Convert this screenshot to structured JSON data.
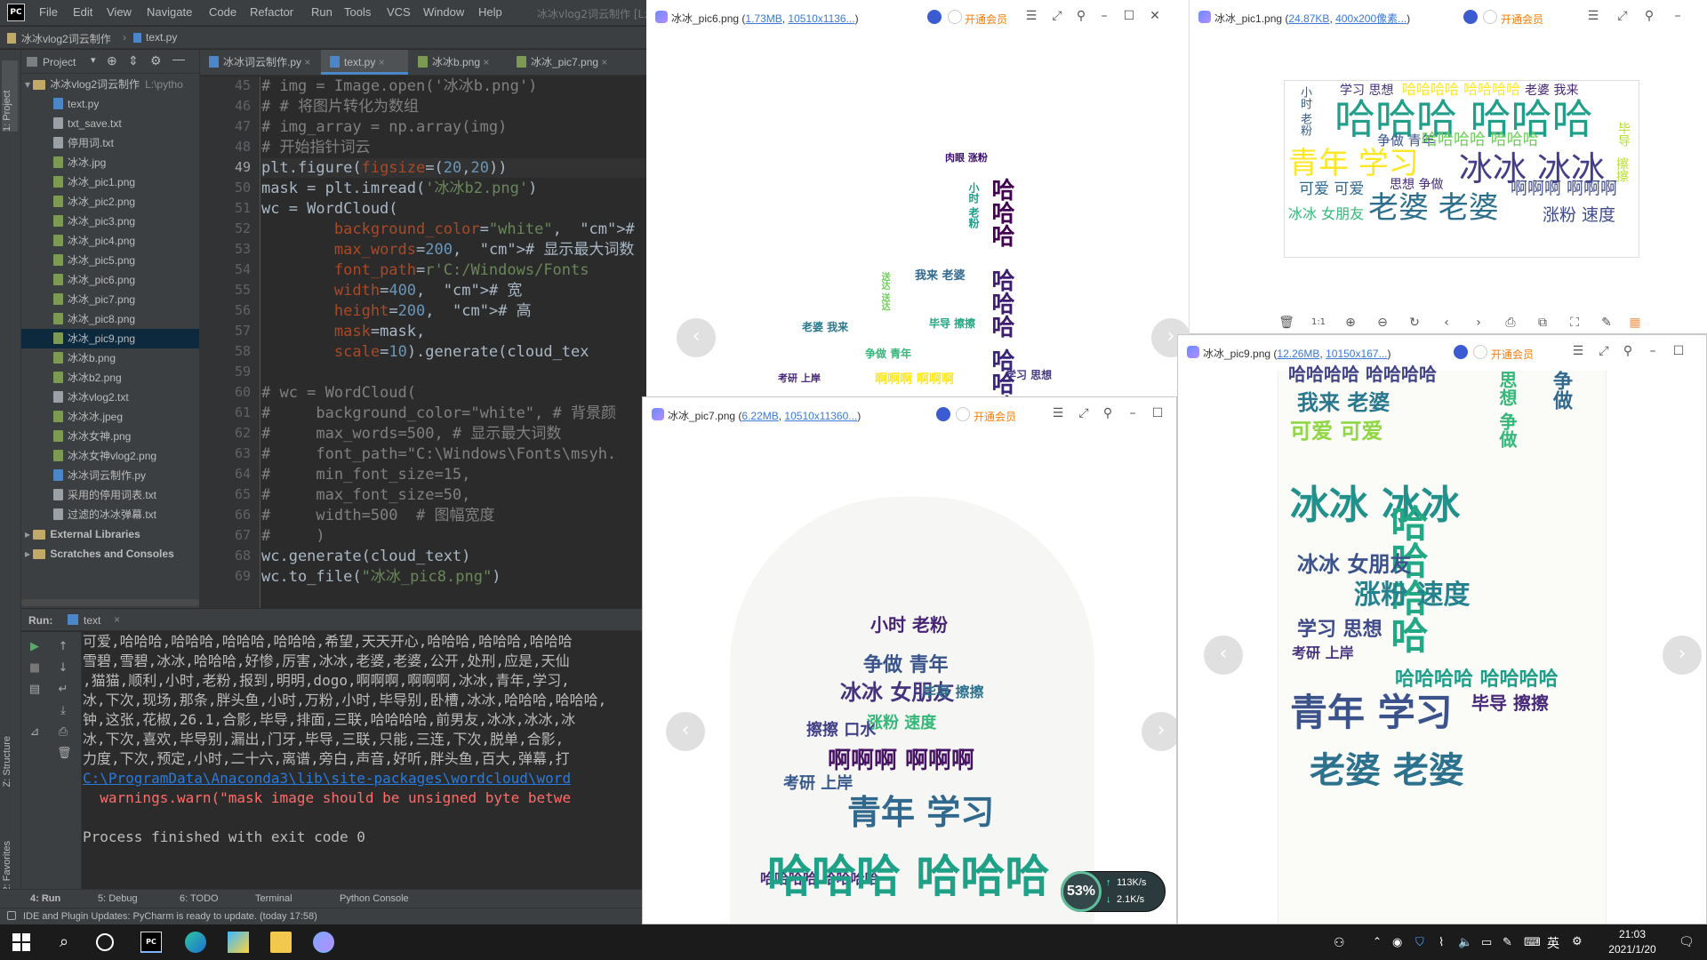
{
  "pycharm": {
    "menus": [
      "File",
      "Edit",
      "View",
      "Navigate",
      "Code",
      "Refactor",
      "Run",
      "Tools",
      "VCS",
      "Window",
      "Help"
    ],
    "window_title": "冰冰vlog2词云制作 [L:",
    "breadcrumb": {
      "project": "冰冰vlog2词云制作",
      "file": "text.py"
    },
    "project_panel": {
      "title": "Project",
      "items": [
        {
          "label": "冰冰vlog2词云制作",
          "suffix": "L:\\pytho",
          "type": "dir",
          "depth": 0
        },
        {
          "label": "text.py",
          "type": "py",
          "depth": 1
        },
        {
          "label": "txt_save.txt",
          "type": "txt",
          "depth": 1
        },
        {
          "label": "停用词.txt",
          "type": "txt",
          "depth": 1
        },
        {
          "label": "冰冰.jpg",
          "type": "img",
          "depth": 1
        },
        {
          "label": "冰冰_pic1.png",
          "type": "img",
          "depth": 1
        },
        {
          "label": "冰冰_pic2.png",
          "type": "img",
          "depth": 1
        },
        {
          "label": "冰冰_pic3.png",
          "type": "img",
          "depth": 1
        },
        {
          "label": "冰冰_pic4.png",
          "type": "img",
          "depth": 1
        },
        {
          "label": "冰冰_pic5.png",
          "type": "img",
          "depth": 1
        },
        {
          "label": "冰冰_pic6.png",
          "type": "img",
          "depth": 1
        },
        {
          "label": "冰冰_pic7.png",
          "type": "img",
          "depth": 1
        },
        {
          "label": "冰冰_pic8.png",
          "type": "img",
          "depth": 1
        },
        {
          "label": "冰冰_pic9.png",
          "type": "img",
          "depth": 1,
          "selected": true
        },
        {
          "label": "冰冰b.png",
          "type": "img",
          "depth": 1
        },
        {
          "label": "冰冰b2.png",
          "type": "img",
          "depth": 1
        },
        {
          "label": "冰冰vlog2.txt",
          "type": "txt",
          "depth": 1
        },
        {
          "label": "冰冰冰.jpeg",
          "type": "img",
          "depth": 1
        },
        {
          "label": "冰冰女神.png",
          "type": "img",
          "depth": 1
        },
        {
          "label": "冰冰女神vlog2.png",
          "type": "img",
          "depth": 1
        },
        {
          "label": "冰冰词云制作.py",
          "type": "py",
          "depth": 1
        },
        {
          "label": "采用的停用词表.txt",
          "type": "txt",
          "depth": 1
        },
        {
          "label": "过滤的冰冰弹幕.txt",
          "type": "txt",
          "depth": 1
        },
        {
          "label": "External Libraries",
          "type": "lib",
          "depth": 0
        },
        {
          "label": "Scratches and Consoles",
          "type": "lib",
          "depth": 0
        }
      ]
    },
    "tabs": [
      {
        "label": "冰冰词云制作.py",
        "active": false
      },
      {
        "label": "text.py",
        "active": true
      },
      {
        "label": "冰冰b.png",
        "active": false
      },
      {
        "label": "冰冰_pic7.png",
        "active": false
      }
    ],
    "code": {
      "line_numbers": [
        "45",
        "46",
        "47",
        "48",
        "49",
        "50",
        "51",
        "52",
        "53",
        "54",
        "55",
        "56",
        "57",
        "58",
        "59",
        "60",
        "61",
        "62",
        "63",
        "64",
        "65",
        "66",
        "67",
        "68",
        "69"
      ],
      "current_line": "49",
      "lines": [
        "# img = Image.open('冰冰b.png')",
        "# # 将图片转化为数组",
        "# img_array = np.array(img)",
        "# 开始指针词云",
        "plt.figure(figsize=(20,20))",
        "mask = plt.imread('冰冰b2.png')",
        "wc = WordCloud(",
        "        background_color=\"white\",  #",
        "        max_words=200,  # 显示最大词数",
        "        font_path=r'C:/Windows/Fonts",
        "        width=400,  # 宽",
        "        height=200,  # 高",
        "        mask=mask,",
        "        scale=10).generate(cloud_tex",
        "",
        "# wc = WordCloud(",
        "#     background_color=\"white\", # 背景颜",
        "#     max_words=500, # 显示最大词数",
        "#     font_path=\"C:\\Windows\\Fonts\\msyh.",
        "#     min_font_size=15,",
        "#     max_font_size=50,",
        "#     width=500  # 图幅宽度",
        "#     )",
        "wc.generate(cloud_text)",
        "wc.to_file(\"冰冰_pic8.png\")"
      ]
    },
    "run": {
      "label": "Run:",
      "tab": "text",
      "console": [
        "可爱,哈哈哈,哈哈哈,哈哈哈,哈哈哈,希望,天天开心,哈哈哈,哈哈哈,哈哈哈",
        "雪碧,雪碧,冰冰,哈哈哈,好惨,厉害,冰冰,老婆,老婆,公开,处刑,应是,天仙",
        ",猫猫,顺利,小时,老粉,报到,明明,dogo,啊啊啊,啊啊啊,冰冰,青年,学习,",
        "冰,下次,现场,那条,胖头鱼,小时,万粉,小时,毕导别,卧槽,冰冰,哈哈哈,哈哈哈,",
        "钟,这张,花椒,26.1,合影,毕导,排面,三联,哈哈哈哈,前男友,冰冰,冰冰,冰",
        "冰,下次,喜欢,毕导别,漏出,门牙,毕导,三联,只能,三连,下次,脱单,合影,",
        "力度,下次,预定,小时,二十六,离谱,旁白,声音,好听,胖头鱼,百大,弹幕,打"
      ],
      "path": "C:\\ProgramData\\Anaconda3\\lib\\site-packages\\wordcloud\\word",
      "warning": "  warnings.warn(\"mask image should be unsigned byte betwe",
      "finished": "Process finished with exit code 0"
    },
    "side_labels": {
      "project": "1: Project",
      "structure": "Z: Structure",
      "favorites": "2: Favorites"
    },
    "bottom_tabs": [
      "4: Run",
      "5: Debug",
      "6: TODO",
      "Terminal",
      "Python Console"
    ],
    "status": "IDE and Plugin Updates: PyCharm is ready to update. (today 17:58)"
  },
  "viewers": {
    "vip_label": "开通会员",
    "pic6": {
      "name": "冰冰_pic6.png",
      "size": "1.73MB",
      "dims": "10510x1136...",
      "words": [
        {
          "t": "肉眼 涨粉",
          "c": "#3b0f70"
        },
        {
          "t": "哈哈哈",
          "c": "#440154"
        },
        {
          "t": "哈哈哈",
          "c": "#3e1c6f"
        },
        {
          "t": "哈哈哈",
          "c": "#38247a"
        },
        {
          "t": "小时 老粉",
          "c": "#1f9e89"
        },
        {
          "t": "我来 老婆",
          "c": "#31688e"
        },
        {
          "t": "送达 送达",
          "c": "#6ece58"
        },
        {
          "t": "老婆 我来",
          "c": "#2a788e"
        },
        {
          "t": "毕导 擦擦",
          "c": "#22a884"
        },
        {
          "t": "争做 青年",
          "c": "#35b779"
        },
        {
          "t": "考研 上岸",
          "c": "#482878"
        },
        {
          "t": "学习 思想",
          "c": "#443983"
        },
        {
          "t": "啊啊啊 啊啊啊",
          "c": "#fde725"
        }
      ]
    },
    "pic1": {
      "name": "冰冰_pic1.png",
      "size": "24.87KB",
      "dims": "400x200像素...",
      "words": [
        {
          "t": "学习 思想",
          "c": "#46327e"
        },
        {
          "t": "哈哈哈哈 哈哈哈哈",
          "c": "#fde725"
        },
        {
          "t": "老婆 我来",
          "c": "#482878"
        },
        {
          "t": "小时 老粉",
          "c": "#365c8d"
        },
        {
          "t": "哈哈哈 哈哈哈",
          "c": "#1f9e89"
        },
        {
          "t": "毕导",
          "c": "#b5de2b"
        },
        {
          "t": "争做 青年",
          "c": "#3b528b"
        },
        {
          "t": "哈哈哈哈 哈哈哈",
          "c": "#6ece58"
        },
        {
          "t": "青年 学习",
          "c": "#fde725"
        },
        {
          "t": "冰冰 冰冰",
          "c": "#433e85"
        },
        {
          "t": "擦擦",
          "c": "#b5de2b"
        },
        {
          "t": "可爱 可爱",
          "c": "#31688e"
        },
        {
          "t": "思想 争做",
          "c": "#472c7a"
        },
        {
          "t": "啊啊啊 啊啊啊",
          "c": "#3e4989"
        },
        {
          "t": "冰冰 女朋友",
          "c": "#35b779"
        },
        {
          "t": "老婆 老婆",
          "c": "#2e6f8e"
        },
        {
          "t": "涨粉 速度",
          "c": "#3e4a89"
        }
      ]
    },
    "pic7": {
      "name": "冰冰_pic7.png",
      "size": "6.22MB",
      "dims": "10510x11360...",
      "words": [
        {
          "t": "小时 老粉",
          "c": "#482475"
        },
        {
          "t": "争做 青年",
          "c": "#3a548c"
        },
        {
          "t": "冰冰 女朋友",
          "c": "#46337e"
        },
        {
          "t": "涨粉 速度",
          "c": "#35b779"
        },
        {
          "t": "毕导 擦擦",
          "c": "#2c728e"
        },
        {
          "t": "擦擦 口水",
          "c": "#424086"
        },
        {
          "t": "啊啊啊 啊啊啊",
          "c": "#471365"
        },
        {
          "t": "考研 上岸",
          "c": "#38598c"
        },
        {
          "t": "青年 学习",
          "c": "#31688e"
        },
        {
          "t": "哈哈哈哈 哈哈哈哈",
          "c": "#482878"
        },
        {
          "t": "哈哈哈 哈哈哈",
          "c": "#1fa188"
        }
      ]
    },
    "pic9": {
      "name": "冰冰_pic9.png",
      "size": "12.26MB",
      "dims": "10150x167...",
      "words": [
        {
          "t": "哈哈哈哈 哈哈哈哈",
          "c": "#414487"
        },
        {
          "t": "我来 老婆",
          "c": "#2a788e"
        },
        {
          "t": "可爱 可爱",
          "c": "#8fd744"
        },
        {
          "t": "冰冰 冰冰",
          "c": "#21918c"
        },
        {
          "t": "哈哈哈哈",
          "c": "#22a884"
        },
        {
          "t": "冰冰 女朋友",
          "c": "#3b528b"
        },
        {
          "t": "涨粉 速度",
          "c": "#26828e"
        },
        {
          "t": "学习 思想",
          "c": "#3e4a89"
        },
        {
          "t": "哈哈哈哈 哈哈哈哈",
          "c": "#1f9e89"
        },
        {
          "t": "青年 学习",
          "c": "#3b528b"
        },
        {
          "t": "老婆 老婆",
          "c": "#2c728e"
        },
        {
          "t": "毕导 擦擦",
          "c": "#482878"
        },
        {
          "t": "考研 上岸",
          "c": "#46327e"
        },
        {
          "t": "思想 争做",
          "c": "#35b779"
        },
        {
          "t": "争做",
          "c": "#31688e"
        }
      ]
    },
    "netmon": {
      "percent": "53%",
      "up": "113K/s",
      "down": "2.1K/s"
    }
  },
  "taskbar": {
    "ime": "英",
    "time": "21:03",
    "date": "2021/1/20"
  }
}
